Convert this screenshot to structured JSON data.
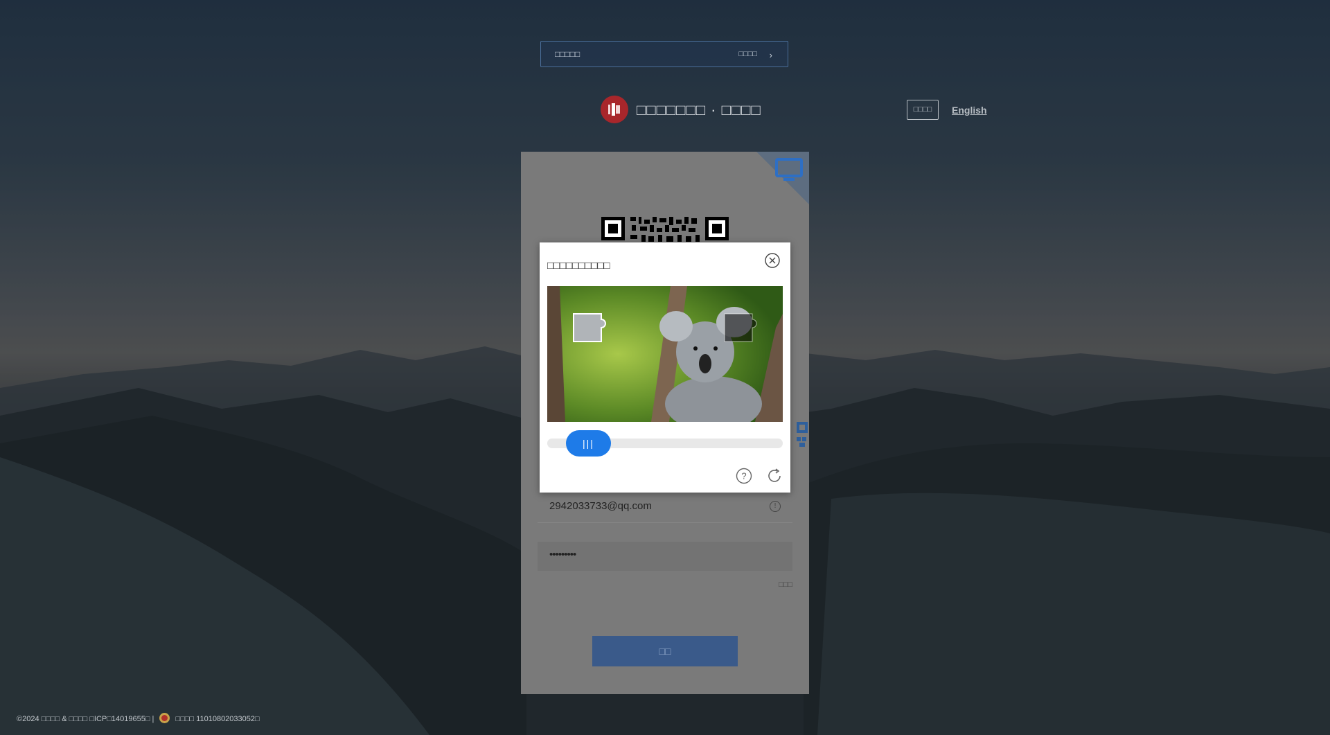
{
  "notice": {
    "text": "□□□□□",
    "more": "□□□□"
  },
  "header": {
    "site_title": "□□□□□□□ · □□□□",
    "lang_cn": "□□□□",
    "lang_en": "English"
  },
  "captcha": {
    "title": "□□□□□□□□□□",
    "slider_grip": "|||"
  },
  "login": {
    "email_value": "2942033733@qq.com",
    "password_value": "•••••••••",
    "forgot": "□□□",
    "submit_label": "□□"
  },
  "footer": {
    "left": "©2024 □□□□ & □□□□ □ICP□14019655□ |",
    "right": "□□□□ 11010802033052□"
  },
  "colors": {
    "accent": "#1e7be8",
    "brand_red": "#a8262b",
    "button": "#3a5a8a"
  },
  "icons": [
    "logo-icon",
    "chevron-right-icon",
    "monitor-icon",
    "qr-code-icon",
    "close-circle-icon",
    "help-icon",
    "refresh-icon",
    "warning-icon",
    "police-badge-icon"
  ]
}
